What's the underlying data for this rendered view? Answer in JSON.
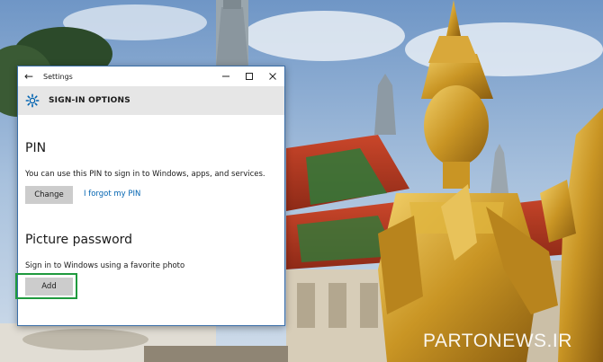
{
  "window": {
    "title": "Settings",
    "back_icon": "←",
    "minimize_icon": "—",
    "maximize_icon": "☐",
    "close_icon": "✕"
  },
  "header": {
    "label": "SIGN-IN OPTIONS",
    "icon": "gear-icon"
  },
  "pin": {
    "title": "PIN",
    "description": "You can use this PIN to sign in to Windows, apps, and services.",
    "change_label": "Change",
    "forgot_label": "I forgot my PIN"
  },
  "picture_password": {
    "title": "Picture password",
    "description": "Sign in to Windows using a favorite photo",
    "add_label": "Add"
  },
  "colors": {
    "accent_link": "#0063b1",
    "highlight_border": "#1f9a3e",
    "header_bg": "#e6e6e6",
    "button_bg": "#cccccc"
  },
  "watermark": "PARTONEWS.IR"
}
